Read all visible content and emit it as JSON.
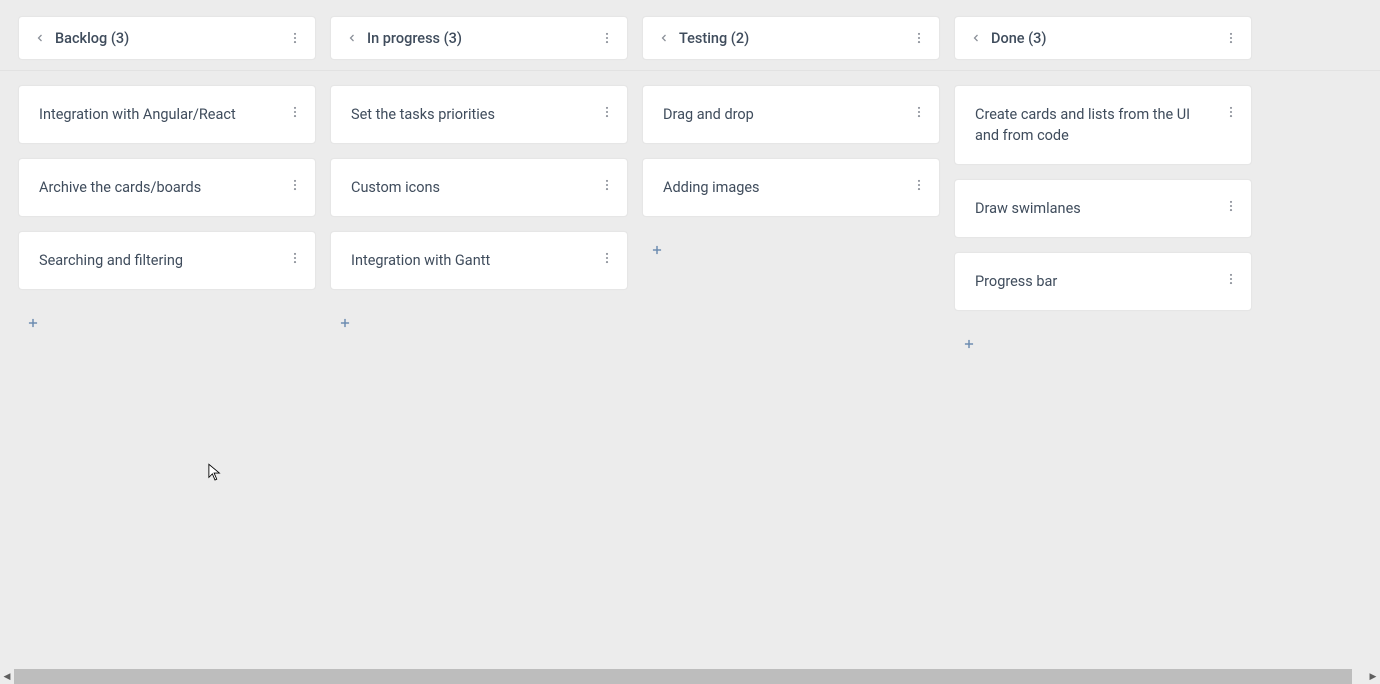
{
  "columns": [
    {
      "id": "backlog",
      "title": "Backlog (3)",
      "cards": [
        {
          "title": "Integration with Angular/React"
        },
        {
          "title": "Archive the cards/boards"
        },
        {
          "title": "Searching and filtering"
        }
      ]
    },
    {
      "id": "in-progress",
      "title": "In progress (3)",
      "cards": [
        {
          "title": "Set the tasks priorities"
        },
        {
          "title": "Custom icons"
        },
        {
          "title": "Integration with Gantt"
        }
      ]
    },
    {
      "id": "testing",
      "title": "Testing (2)",
      "cards": [
        {
          "title": "Drag and drop"
        },
        {
          "title": "Adding images"
        }
      ]
    },
    {
      "id": "done",
      "title": "Done (3)",
      "cards": [
        {
          "title": "Create cards and lists from the UI and from code"
        },
        {
          "title": "Draw swimlanes"
        },
        {
          "title": "Progress bar"
        }
      ]
    }
  ]
}
